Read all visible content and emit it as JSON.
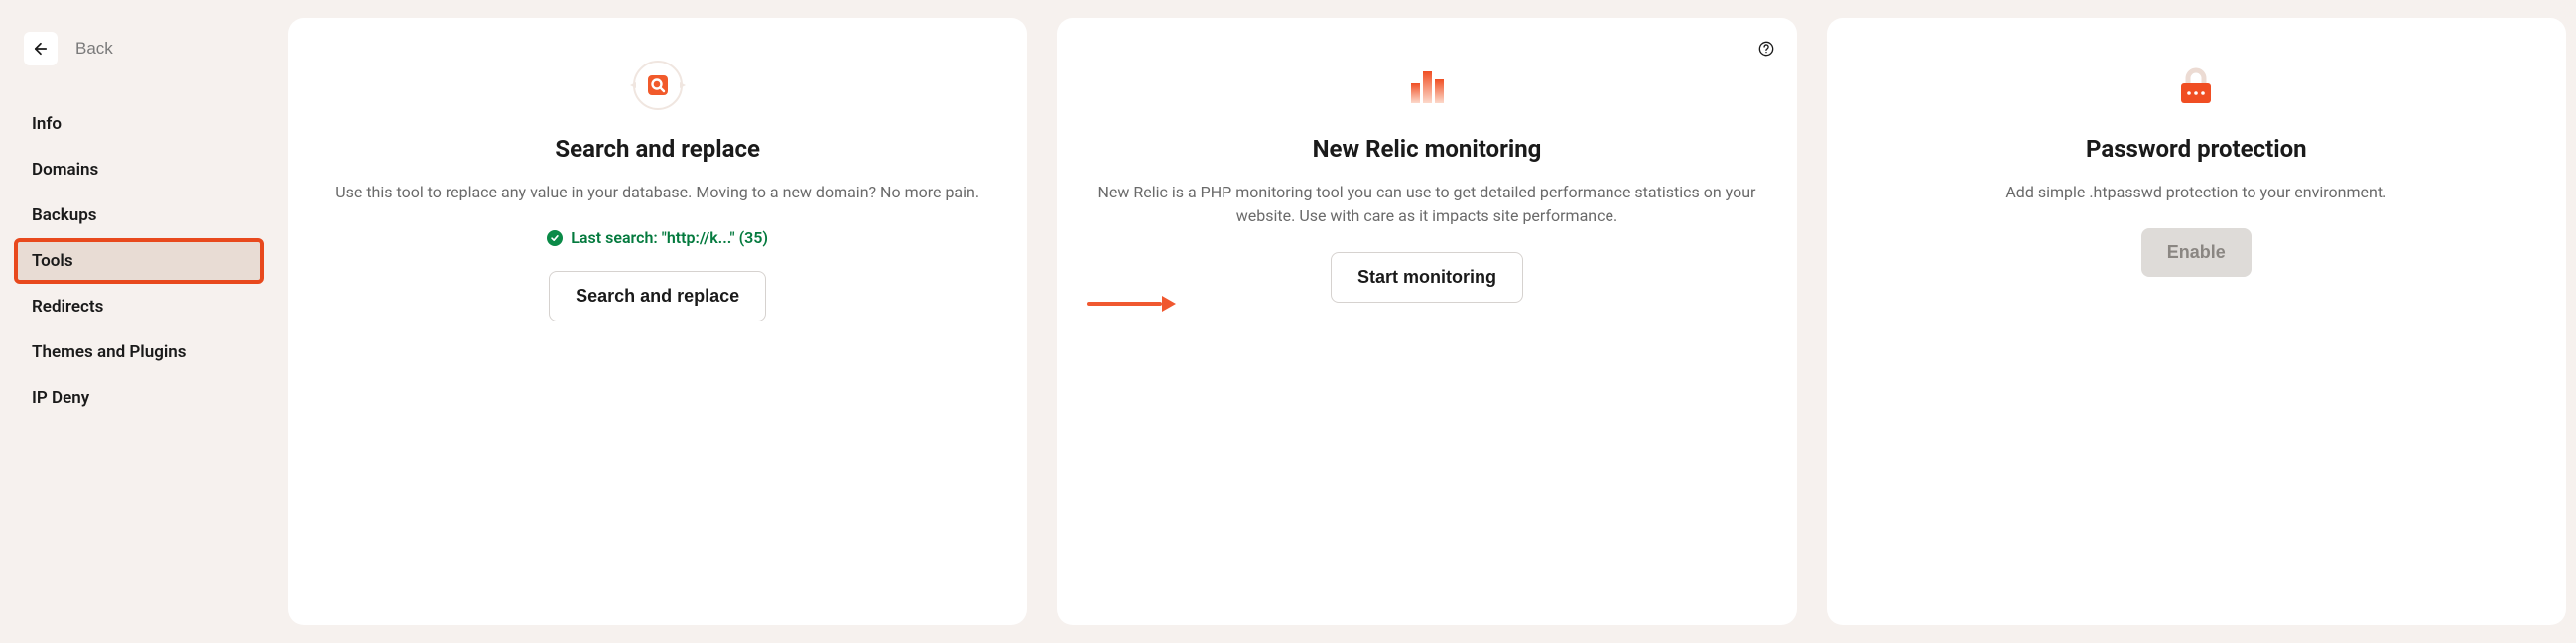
{
  "back": {
    "label": "Back"
  },
  "sidebar": {
    "items": [
      {
        "label": "Info"
      },
      {
        "label": "Domains"
      },
      {
        "label": "Backups"
      },
      {
        "label": "Tools"
      },
      {
        "label": "Redirects"
      },
      {
        "label": "Themes and Plugins"
      },
      {
        "label": "IP Deny"
      }
    ]
  },
  "cards": {
    "search_replace": {
      "title": "Search and replace",
      "desc": "Use this tool to replace any value in your database. Moving to a new domain? No more pain.",
      "status": "Last search: \"http://k...\" (35)",
      "button": "Search and replace"
    },
    "new_relic": {
      "title": "New Relic monitoring",
      "desc": "New Relic is a PHP monitoring tool you can use to get detailed performance statistics on your website. Use with care as it impacts site performance.",
      "button": "Start monitoring"
    },
    "password": {
      "title": "Password protection",
      "desc": "Add simple .htpasswd protection to your environment.",
      "button": "Enable"
    }
  }
}
